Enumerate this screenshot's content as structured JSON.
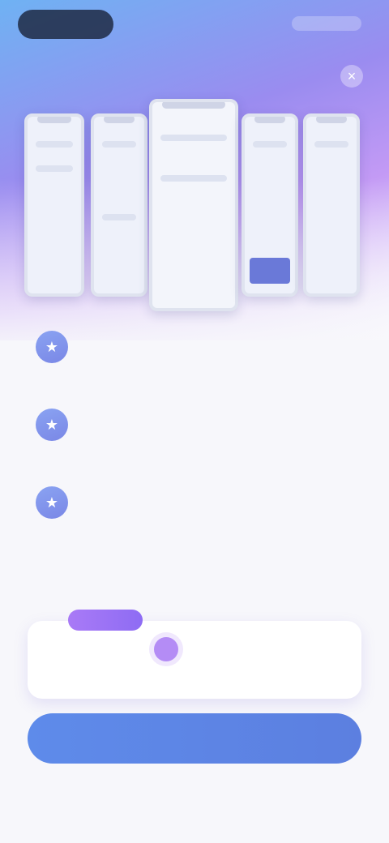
{
  "topbar": {
    "close_symbol": "×"
  },
  "icons": {
    "status": "status-pill",
    "close": "close-icon",
    "feature": "star-icon"
  },
  "features": [
    {
      "title": "",
      "desc": ""
    },
    {
      "title": "",
      "desc": ""
    },
    {
      "title": "",
      "desc": ""
    }
  ],
  "plans": {
    "tag": "",
    "left": {
      "label": "",
      "price": ""
    },
    "right": {
      "label": "",
      "price": ""
    }
  },
  "cta": {
    "label": ""
  },
  "footer": {
    "links": [
      "",
      "",
      ""
    ]
  },
  "colors": {
    "accent": "#5e8bea",
    "tag_purple": "#a97af6"
  }
}
